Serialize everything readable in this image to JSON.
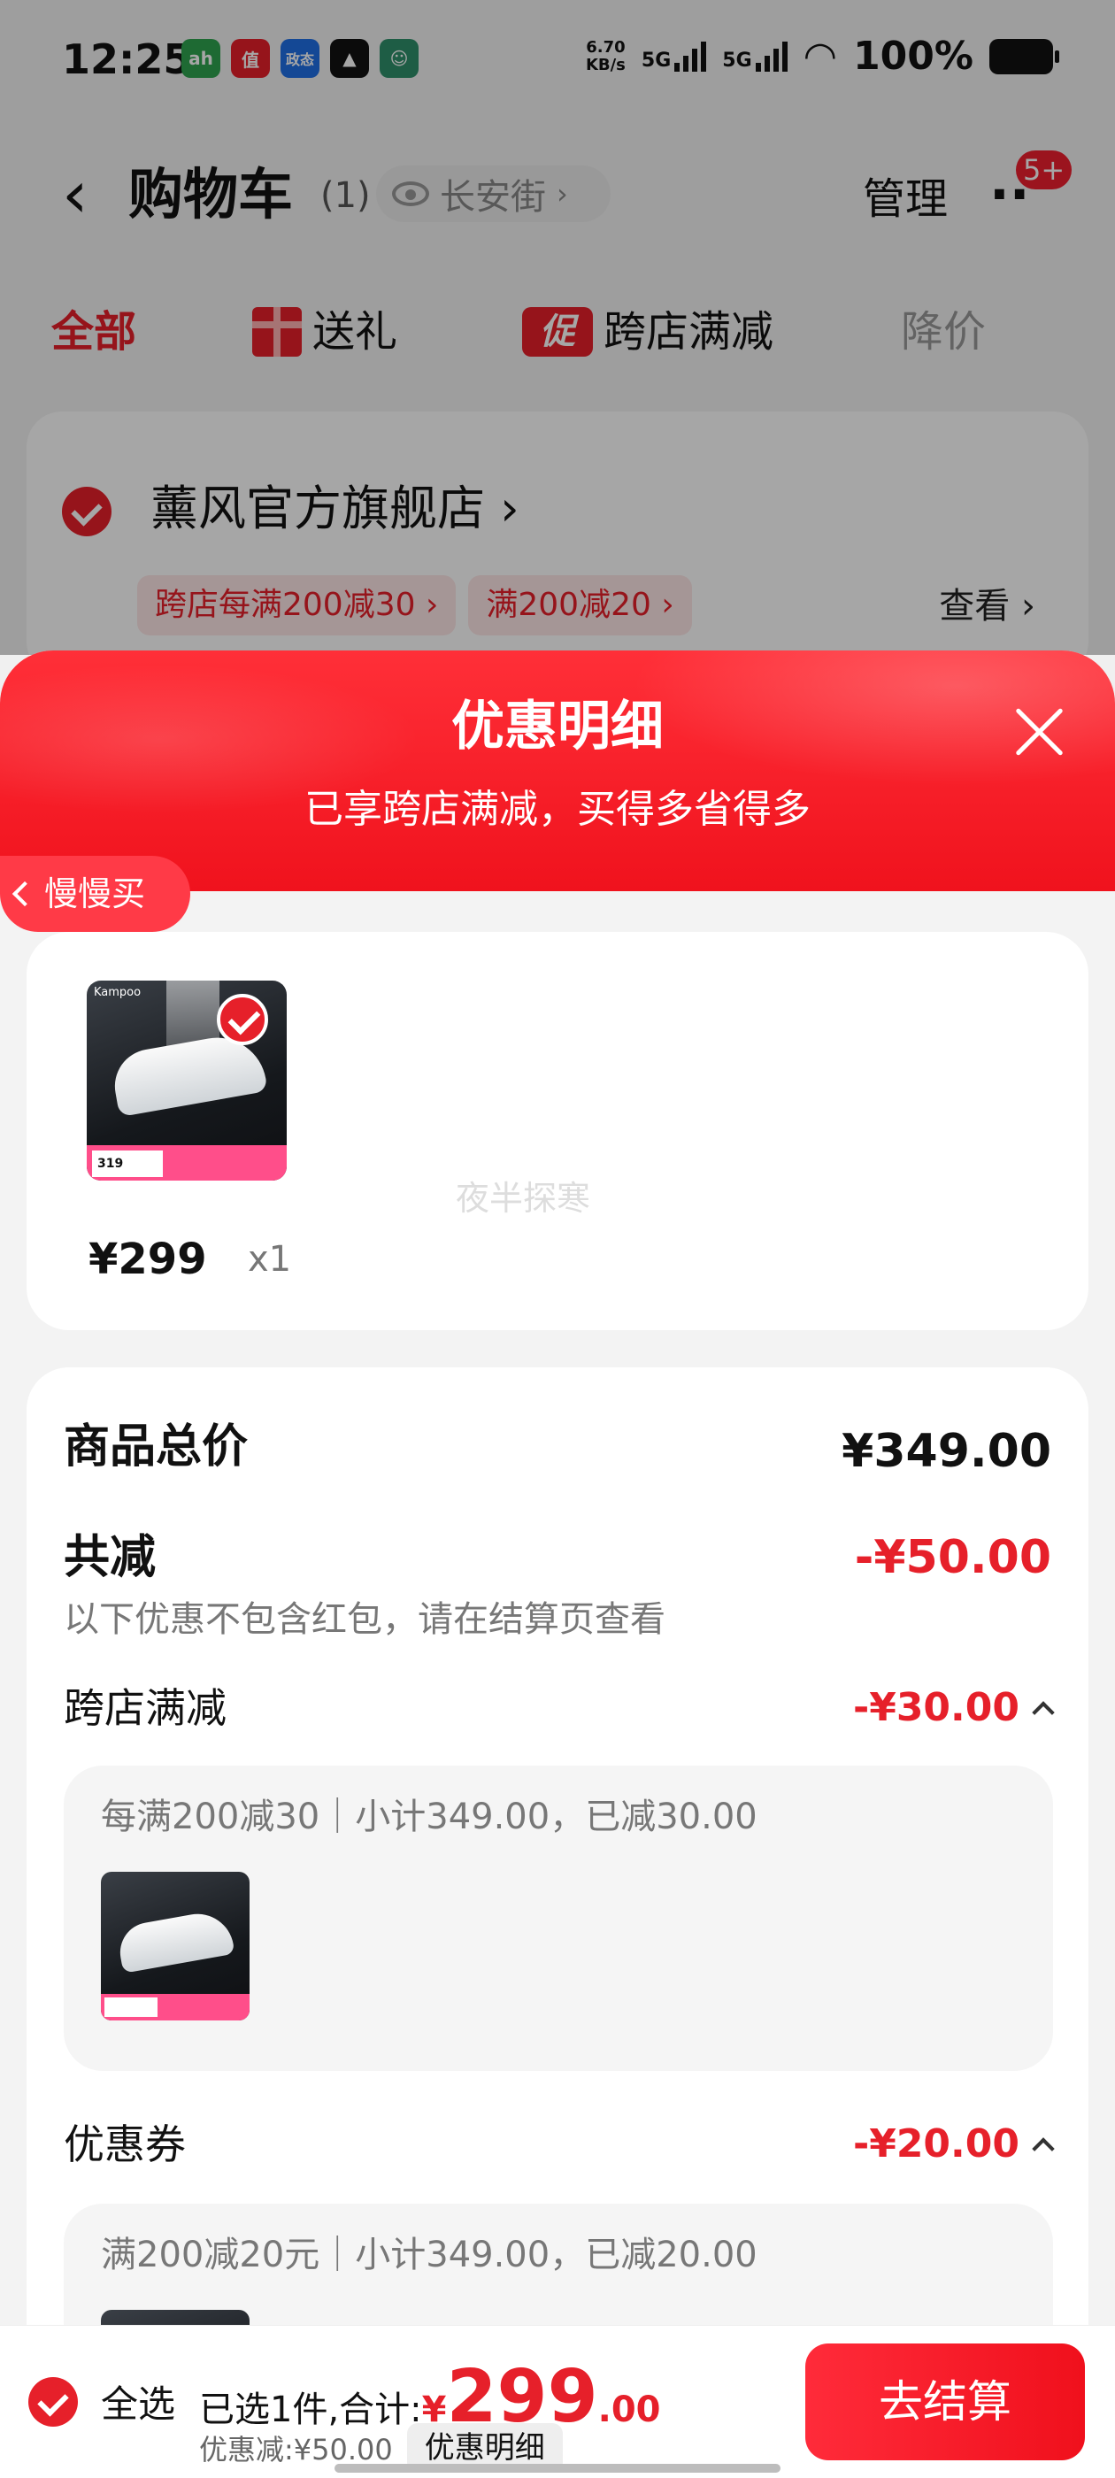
{
  "status_bar": {
    "time": "12:25",
    "apps": [
      {
        "icon": "app-icon-1",
        "label": "ah",
        "color": "#2fa34f"
      },
      {
        "icon": "app-icon-2",
        "label": "值",
        "color": "#e6202a"
      },
      {
        "icon": "app-icon-3",
        "label": "政态",
        "color": "#1f6fe5"
      },
      {
        "icon": "app-icon-4",
        "label": "",
        "color": "#111111"
      },
      {
        "icon": "app-icon-5",
        "label": "",
        "color": "#2f8f6a"
      }
    ],
    "net_speed_value": "6.70",
    "net_speed_unit": "KB/s",
    "signal1": "5G",
    "signal2": "5G",
    "battery": "100%"
  },
  "nav": {
    "title": "购物车",
    "count": "(1)",
    "location": "长安街",
    "manage": "管理",
    "more_badge": "5+"
  },
  "filter_tabs": [
    {
      "label": "全部",
      "active": true
    },
    {
      "label": "送礼",
      "icon": "gift-icon"
    },
    {
      "label": "跨店满减",
      "icon": "promo-icon",
      "icon_text": "促"
    },
    {
      "label": "降价"
    }
  ],
  "store": {
    "name": "薰风官方旗舰店",
    "tags": [
      "跨店每满200减30",
      "满200减20"
    ],
    "view": "查看"
  },
  "sheet": {
    "title": "优惠明细",
    "subtitle": "已享跨店满减，买得多省得多",
    "slow_buy": "慢慢买",
    "watermark": "夜半探寒",
    "product": {
      "price": "¥299",
      "qty": "x1",
      "thumb_price": "319",
      "thumb_brand": "Kampoo"
    },
    "summary": {
      "total_label": "商品总价",
      "total_value": "¥349.00",
      "discount_label": "共减",
      "discount_value": "-¥50.00",
      "discount_note": "以下优惠不包含红包，请在结算页查看"
    },
    "sections": [
      {
        "label": "跨店满减",
        "value": "-¥30.00",
        "detail": "每满200减30｜小计349.00，已减30.00"
      },
      {
        "label": "优惠券",
        "value": "-¥20.00",
        "detail": "满200减20元｜小计349.00，已减20.00"
      }
    ]
  },
  "bottom_bar": {
    "select_all": "全选",
    "selected_label": "已选1件,合计:",
    "currency": "¥",
    "total_int": "299",
    "total_dec": ".00",
    "discount_text": "优惠减:¥50.00",
    "detail_chip": "优惠明细",
    "checkout": "去结算"
  },
  "colors": {
    "accent": "#e6202a",
    "header_red": "#f0121d"
  }
}
